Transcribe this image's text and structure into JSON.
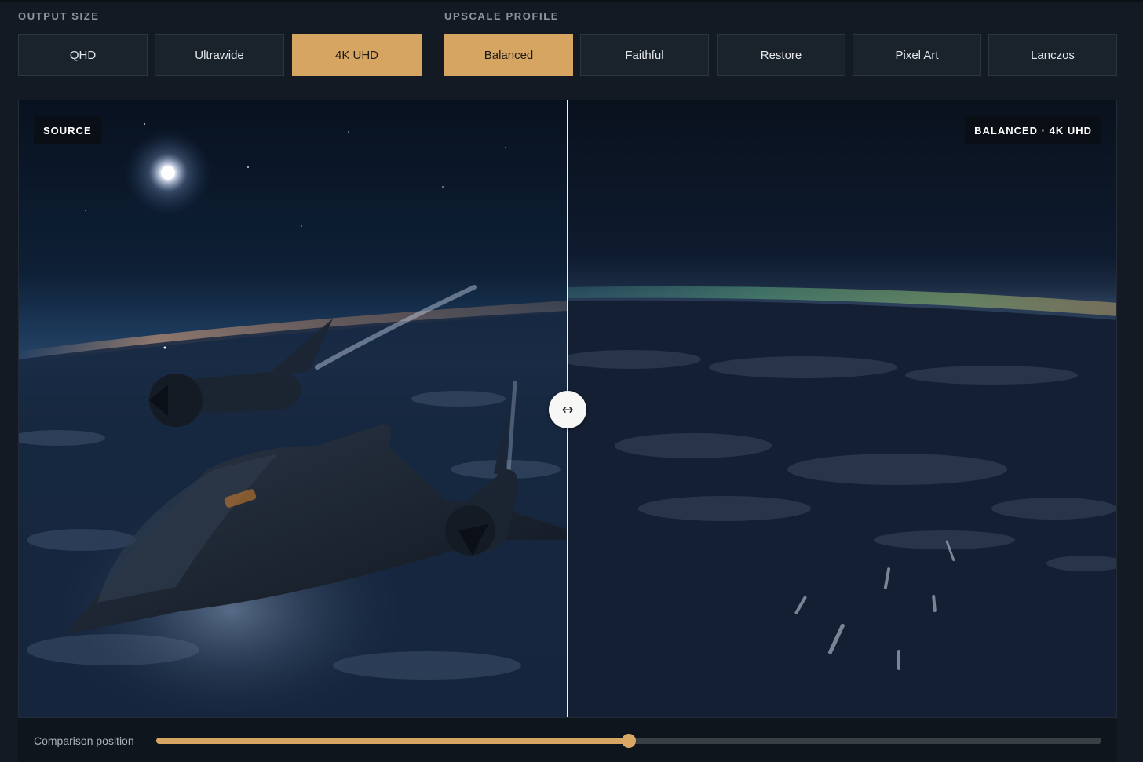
{
  "output_size": {
    "label": "OUTPUT SIZE",
    "options": [
      "QHD",
      "Ultrawide",
      "4K UHD"
    ],
    "selected": "4K UHD"
  },
  "upscale_profile": {
    "label": "UPSCALE PROFILE",
    "options": [
      "Balanced",
      "Faithful",
      "Restore",
      "Pixel Art",
      "Lanczos"
    ],
    "selected": "Balanced"
  },
  "comparison": {
    "left_badge": "SOURCE",
    "right_badge": "BALANCED · 4K UHD",
    "handle_icon": "↔"
  },
  "slider": {
    "label": "Comparison position",
    "value_fraction": 0.5
  },
  "colors": {
    "accent": "#d7a562",
    "background": "#131a23",
    "button": "#1a222c"
  }
}
